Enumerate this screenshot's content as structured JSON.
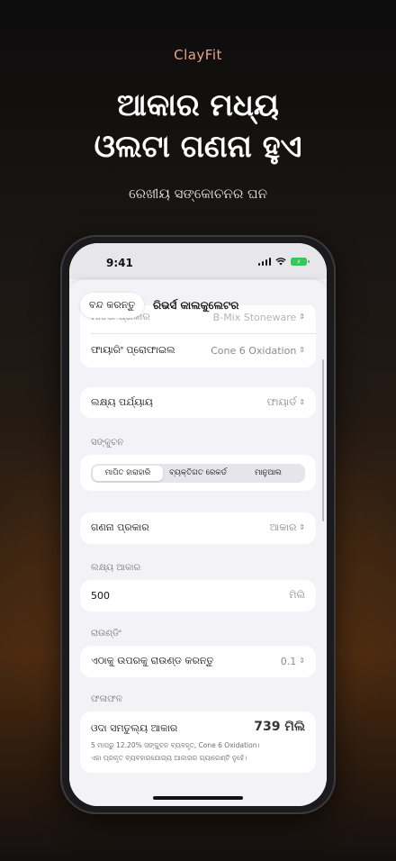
{
  "promo": {
    "brand": "ClayFit",
    "headline_line1": "ଆକାର ମଧ୍ୟ",
    "headline_line2": "ଓଲଟା ଗଣନା ହୁଏ",
    "subtitle": "ରେଖୀୟ ସଙ୍କୋଚନର ଘନ"
  },
  "status_bar": {
    "time": "9:41"
  },
  "nav": {
    "close_label": "ବନ୍ଦ କରନ୍ତୁ",
    "title": "ରିଭର୍ସ କାଲକୁଲେଟର"
  },
  "clay": {
    "clay_type_label": "ମାଟିର ପ୍ରକାର",
    "clay_type_value": "B-Mix Stoneware",
    "firing_profile_label": "ଫାୟାରିଂ ପ୍ରୋଫାଇଲ",
    "firing_profile_value": "Cone 6 Oxidation"
  },
  "stage": {
    "label": "ଲକ୍ଷ୍ୟ ପର୍ଯ୍ୟାୟ",
    "value": "ଫାୟାର୍ଡ"
  },
  "shrinkage": {
    "section_title": "ସଙ୍କୁଚନ",
    "options": [
      "ମାପିତ ହାରାହାରି",
      "ବ୍ୟକ୍ତିଗତ ରେକର୍ଡ",
      "ମାନୁଆଲ"
    ],
    "selected_index": 0
  },
  "calc_type": {
    "label": "ଗଣନା ପ୍ରକାର",
    "value": "ଆକାର"
  },
  "target_size": {
    "section_title": "ଲକ୍ଷ୍ୟ ଆକାର",
    "value": "500",
    "unit": "ମିଲି"
  },
  "rounding": {
    "section_title": "ରାଉଣ୍ଡିଂ",
    "label": "ଏଠାକୁ ଉପରକୁ ରାଉଣ୍ଡ କରନ୍ତୁ",
    "value": "0.1"
  },
  "result": {
    "section_title": "ଫଳାଫଳ",
    "label": "ଓଦା ସମତୁଲ୍ୟ ଆକାର",
    "value": "739 ମିଲି",
    "note_line1": "5 ମାପରୁ 12.20% ସଙ୍କୁଚନ ବ୍ୟବହୃତ, Cone 6 Oxidation।",
    "note_line2": "ଏହା ପ୍ରକୃତ ବ୍ୟବହାରଯୋଗ୍ୟ ଆକାରର ଗ୍ୟାରେଣ୍ଟି ନୁହେଁ।"
  },
  "colors": {
    "accent_brand": "#e8a58c",
    "battery": "#34c759",
    "sheet_bg": "#f2f2f7"
  }
}
